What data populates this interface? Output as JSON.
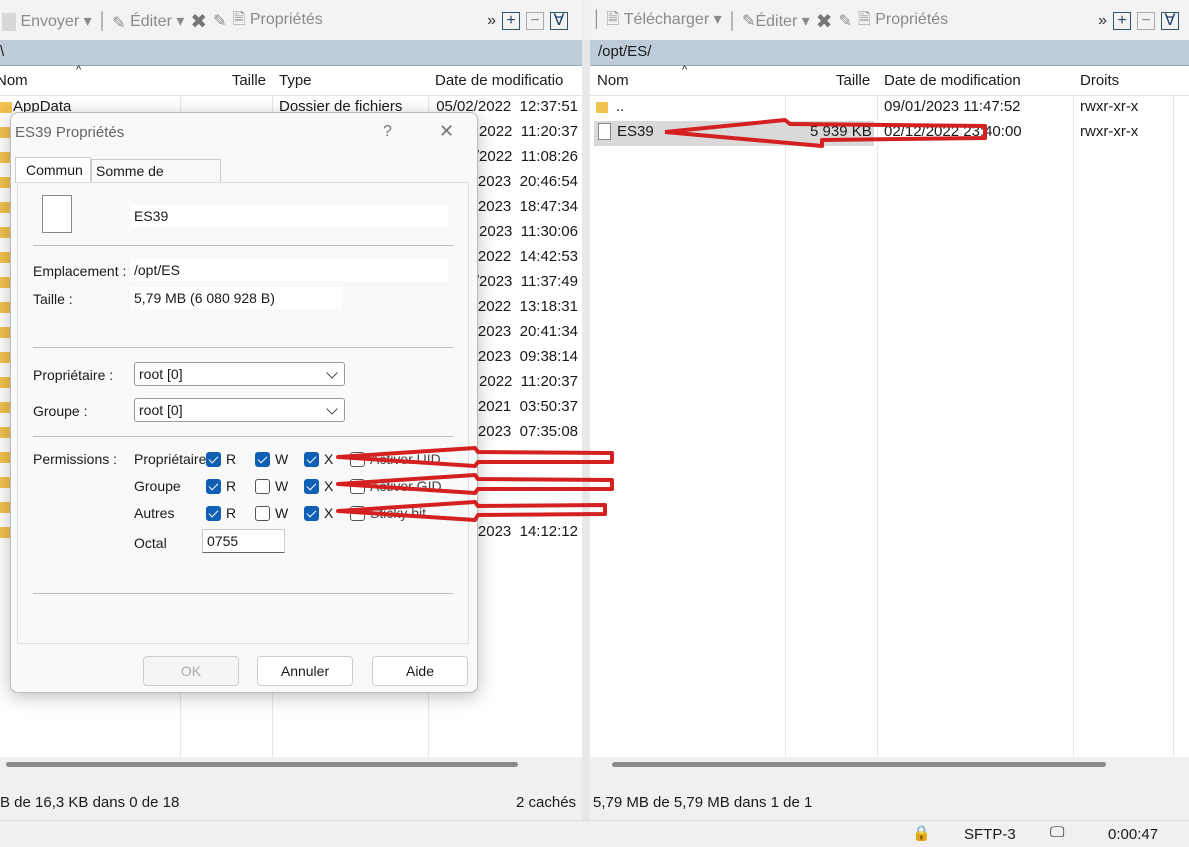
{
  "left_toolbar": {
    "upload": "Envoyer",
    "edit": "Éditer",
    "properties": "Propriétés"
  },
  "right_toolbar": {
    "download": "Télécharger",
    "edit": "Éditer",
    "properties": "Propriétés"
  },
  "left_path": "\\",
  "right_path": "/opt/ES/",
  "left_columns": {
    "name": "Nom",
    "size": "Taille",
    "type": "Type",
    "date": "Date de modificatio"
  },
  "right_columns": {
    "name": "Nom",
    "size": "Taille",
    "date": "Date de modification",
    "rights": "Droits"
  },
  "left_rows": [
    {
      "name": "AppData",
      "type": "Dossier de fichiers",
      "date": "05/02/2022  12:37:51"
    },
    {
      "date": "2022  11:20:37"
    },
    {
      "date": "/2022  11:08:26"
    },
    {
      "date": "2023  20:46:54"
    },
    {
      "date": "2023  18:47:34"
    },
    {
      "date": "2023  11:30:06"
    },
    {
      "date": "2022  14:42:53"
    },
    {
      "date": "/2023  11:37:49"
    },
    {
      "date": "/2022  13:18:31"
    },
    {
      "date": "2023  20:41:34"
    },
    {
      "date": "2023  09:38:14"
    },
    {
      "date": "2022  11:20:37"
    },
    {
      "date": "/2021  03:50:37"
    },
    {
      "date": "2023  07:35:08"
    },
    {
      "date": ""
    },
    {
      "date": ""
    },
    {
      "date": ""
    },
    {
      "date": "/2023  14:12:12"
    }
  ],
  "right_rows": [
    {
      "name": "..",
      "size": "",
      "date": "09/01/2023 11:47:52",
      "rights": "rwxr-xr-x"
    },
    {
      "name": "ES39",
      "size": "5 939 KB",
      "date": "02/12/2022 23:40:00",
      "rights": "rwxr-xr-x"
    }
  ],
  "left_status": {
    "selection": "B de 16,3 KB dans 0 de 18",
    "hidden": "2 cachés"
  },
  "right_status": {
    "selection": "5,79 MB de 5,79 MB dans 1 de 1"
  },
  "bottom_bar": {
    "protocol": "SFTP-3",
    "elapsed": "0:00:47"
  },
  "dialog": {
    "title": "ES39 Propriétés",
    "help": "?",
    "tabs": [
      "Commun",
      "Somme de contrôle"
    ],
    "filename": "ES39",
    "location_label": "Emplacement :",
    "location": "/opt/ES",
    "size_label": "Taille :",
    "size": "5,79 MB (6 080 928 B)",
    "owner_label": "Propriétaire :",
    "owner": "root [0]",
    "group_label": "Groupe :",
    "group": "root [0]",
    "permissions_label": "Permissions :",
    "perm_rows": [
      {
        "label": "Propriétaire",
        "r": true,
        "w": true,
        "x": true,
        "extra": "Activer UID",
        "extra_on": false
      },
      {
        "label": "Groupe",
        "r": true,
        "w": false,
        "x": true,
        "extra": "Activer GID",
        "extra_on": false
      },
      {
        "label": "Autres",
        "r": true,
        "w": false,
        "x": true,
        "extra": "Sticky bit",
        "extra_on": false
      }
    ],
    "rwx": [
      "R",
      "W",
      "X"
    ],
    "octal_label": "Octal",
    "octal": "0755",
    "ok": "OK",
    "cancel": "Annuler",
    "help_btn": "Aide"
  },
  "annotation_color": "#d42020"
}
